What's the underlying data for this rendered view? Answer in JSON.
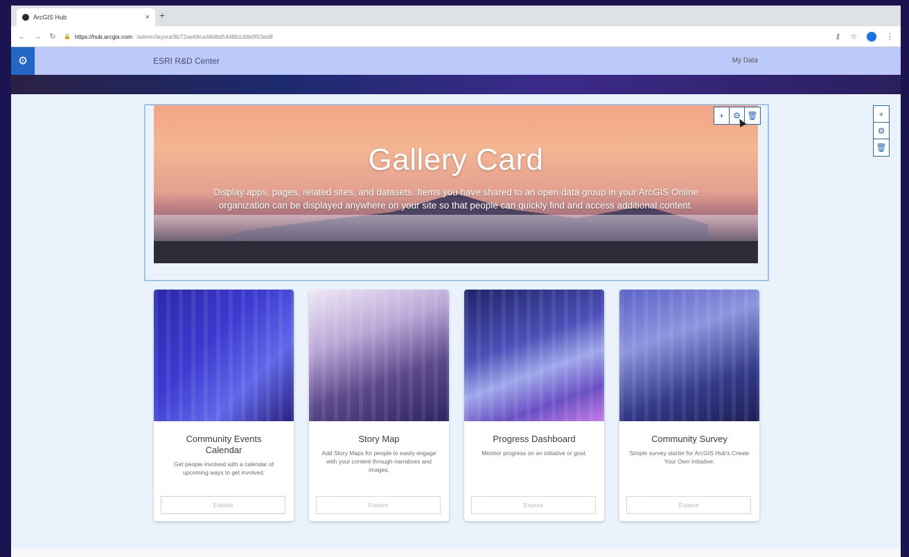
{
  "browser": {
    "tab_title": "ArcGIS Hub",
    "tab_close": "×",
    "new_tab": "+",
    "url_host": "https://hub.arcgis.com",
    "url_path": "/admin/layout/8b72ae68ca48d8d5448b1d0b0f53ed8"
  },
  "site": {
    "title": "ESRI R&D Center",
    "nav_link": "My Data",
    "gear_icon": "⚙",
    "brand_color": "#2466c4"
  },
  "hero": {
    "title": "Gallery Card",
    "description": "Display apps, pages, related sites, and datasets. Items you have shared to an open data group in your ArcGIS Online organization can be displayed anywhere on your site so that people can quickly find and access additional content."
  },
  "tools": {
    "add": "+",
    "settings": "⚙",
    "delete": "🗑"
  },
  "cards": [
    {
      "title": "Community Events Calendar",
      "description": "Get people involved with a calendar of upcoming ways to get involved.",
      "button": "Explore"
    },
    {
      "title": "Story Map",
      "description": "Add Story Maps for people to easily engage with your content through narratives and images.",
      "button": "Explore"
    },
    {
      "title": "Progress Dashboard",
      "description": "Monitor progress on an initiative or goal.",
      "button": "Explore"
    },
    {
      "title": "Community Survey",
      "description": "Simple survey starter for ArcGIS Hub's Create Your Own Initiative.",
      "button": "Explore"
    }
  ]
}
